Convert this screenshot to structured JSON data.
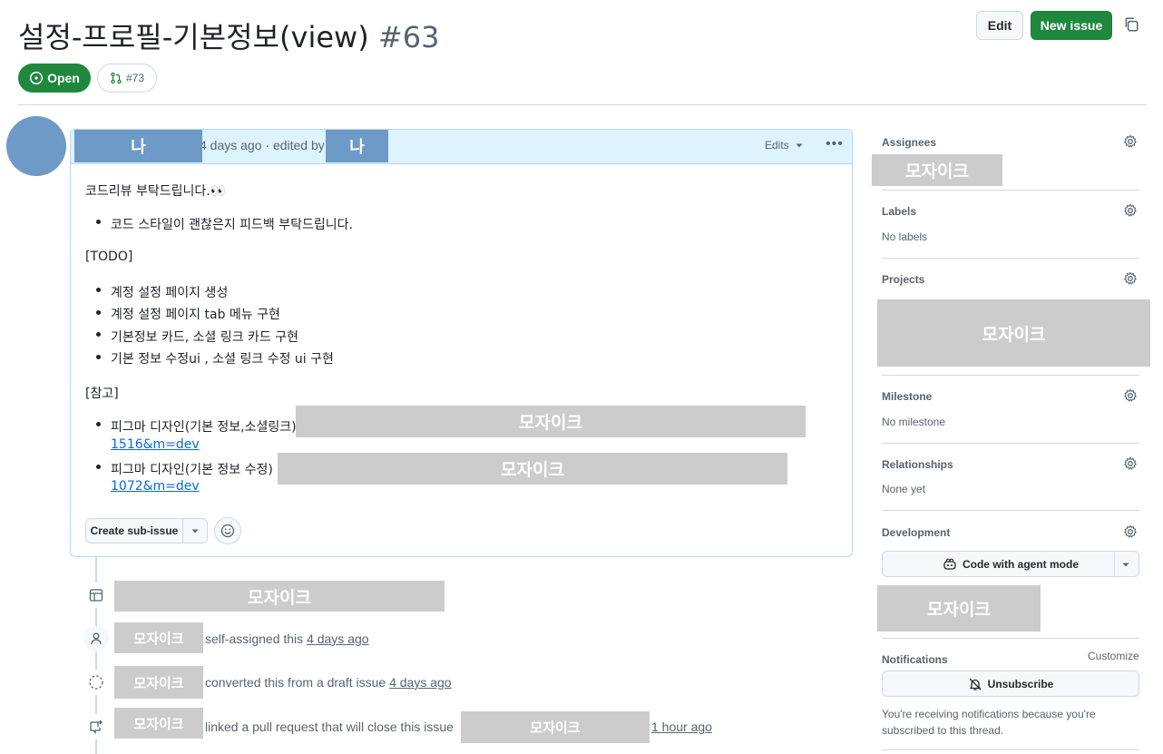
{
  "issue": {
    "title": "설정-프로필-기본정보(view)",
    "number": "#63",
    "state": "Open",
    "linked_pr": "#73"
  },
  "header_actions": {
    "edit_label": "Edit",
    "new_issue_label": "New issue"
  },
  "comment": {
    "author": "나",
    "editor": "나",
    "meta": "4 days ago · edited by",
    "edits_label": "Edits",
    "intro": "코드리뷰 부탁드립니다.👀",
    "intro_bullets": [
      "코드 스타일이 괜찮은지 피드백 부탁드립니다."
    ],
    "todo_heading": "[TODO]",
    "todo_items": [
      "계정 설정 페이지 생성",
      "계정 설정 페이지 tab 메뉴 구현",
      "기본정보 카드, 소셜 링크 카드 구현",
      "기본 정보 수정ui , 소셜 링크 수정 ui 구현"
    ],
    "ref_heading": "[참고]",
    "refs": [
      {
        "label": "피그마 디자인(기본 정보,소셜링크)",
        "link_tail": "1516&m=dev"
      },
      {
        "label": "피그마 디자인(기본 정보 수정) :",
        "link_tail": "1072&m=dev"
      }
    ],
    "create_sub_issue_label": "Create sub-issue"
  },
  "mosaic_label": "모자이크",
  "timeline": [
    {
      "icon": "table-icon",
      "text": ""
    },
    {
      "icon": "person-icon",
      "text": "self-assigned this",
      "time": "4 days ago"
    },
    {
      "icon": "draft-circle-icon",
      "text": "converted this from a draft issue",
      "time": "4 days ago"
    },
    {
      "icon": "cross-reference-icon",
      "text": "linked a pull request that will close this issue",
      "time": "1 hour ago"
    }
  ],
  "sidebar": {
    "assignees": {
      "label": "Assignees"
    },
    "labels": {
      "label": "Labels",
      "value": "No labels"
    },
    "projects": {
      "label": "Projects"
    },
    "milestone": {
      "label": "Milestone",
      "value": "No milestone"
    },
    "relationships": {
      "label": "Relationships",
      "value": "None yet"
    },
    "development": {
      "label": "Development",
      "agent_button": "Code with agent mode"
    },
    "notifications": {
      "label": "Notifications",
      "customize": "Customize",
      "unsubscribe": "Unsubscribe",
      "reason": "You're receiving notifications because you're subscribed to this thread."
    }
  }
}
